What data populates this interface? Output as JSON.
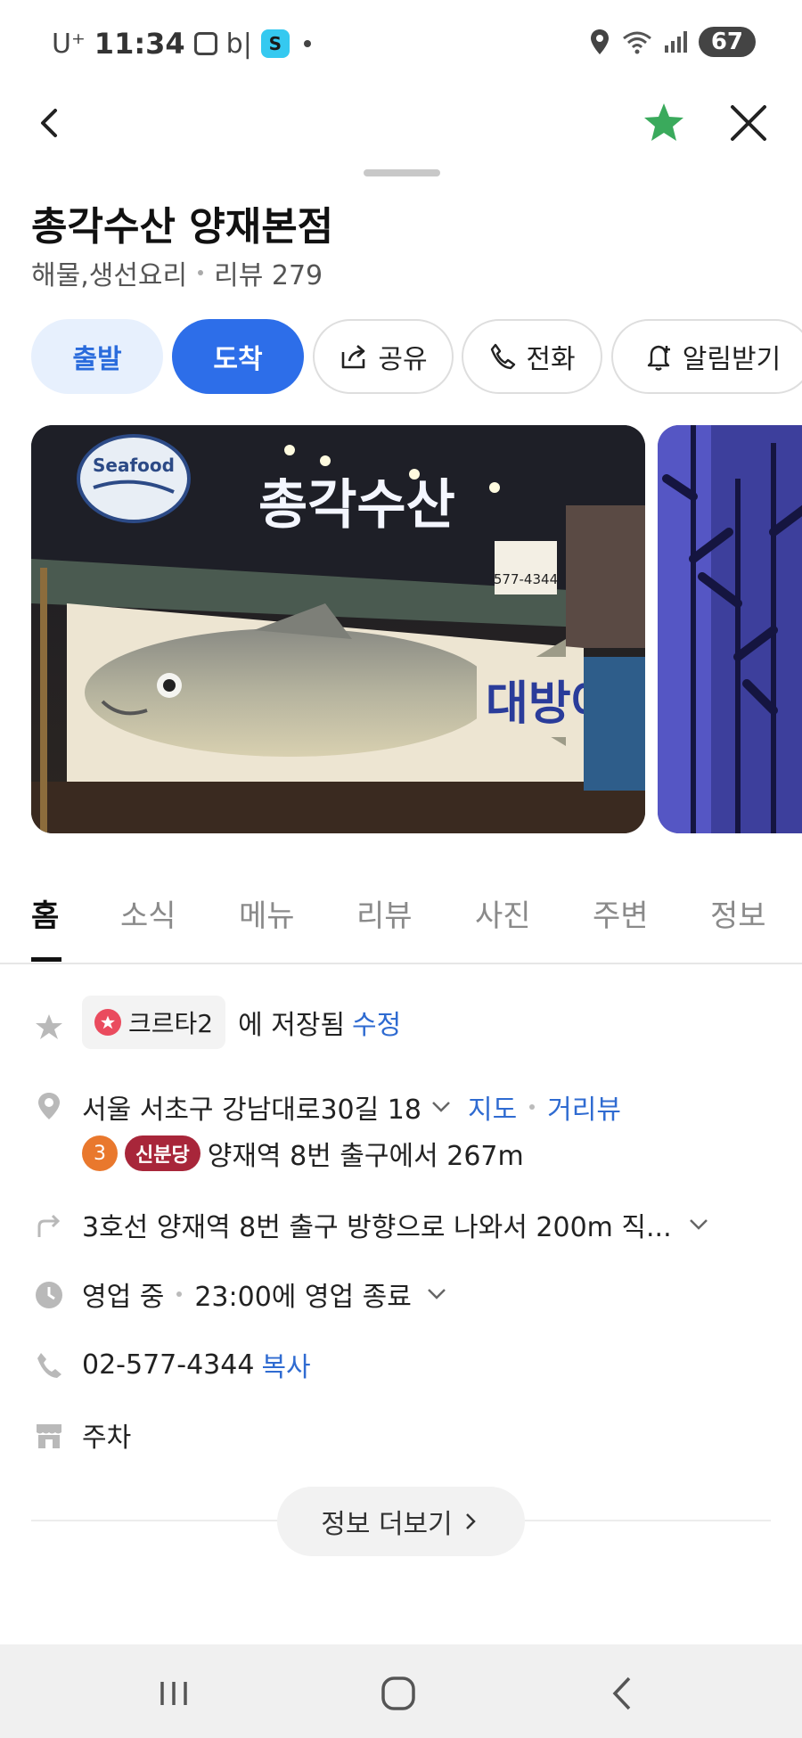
{
  "status_bar": {
    "carrier": "U⁺",
    "time": "11:34",
    "extra": "b|",
    "battery": "67"
  },
  "place": {
    "name": "총각수산 양재본점",
    "category": "해물,생선요리",
    "review_label": "리뷰 279"
  },
  "actions": {
    "depart": "출발",
    "arrive": "도착",
    "share": "공유",
    "call": "전화",
    "alarm": "알림받기"
  },
  "photo": {
    "badge": "Seafood",
    "sign_text": "총각수산",
    "phone_sign": "577-4344",
    "banner_text": "대방어"
  },
  "tabs": [
    "홈",
    "소식",
    "메뉴",
    "리뷰",
    "사진",
    "주변",
    "정보"
  ],
  "saved": {
    "list_name": "크르타2",
    "saved_text": "에 저장됨",
    "edit": "수정"
  },
  "address": {
    "text": "서울 서초구 강남대로30길 18",
    "map_link": "지도",
    "street_view_link": "거리뷰",
    "line_number": "3",
    "line_name": "신분당",
    "station_text": "양재역 8번 출구에서 267m"
  },
  "directions": {
    "text": "3호선 양재역 8번 출구 방향으로 나와서 200m 직..."
  },
  "hours": {
    "status": "영업 중",
    "close_text": "23:00에 영업 종료"
  },
  "phone": {
    "number": "02-577-4344",
    "copy": "복사"
  },
  "parking": {
    "text": "주차"
  },
  "more_info": {
    "label": "정보 더보기"
  },
  "colors": {
    "accent_blue": "#2d6ee9",
    "star_green": "#3aaa5c",
    "link_blue": "#2f6bd1"
  }
}
